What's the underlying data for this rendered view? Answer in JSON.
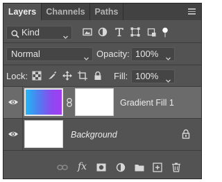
{
  "tabs": [
    {
      "label": "Layers",
      "active": true
    },
    {
      "label": "Channels",
      "active": false
    },
    {
      "label": "Paths",
      "active": false
    }
  ],
  "filter": {
    "type_value": "Kind"
  },
  "blend": {
    "mode": "Normal",
    "opacity_label": "Opacity:",
    "opacity_value": "100%"
  },
  "lock": {
    "label": "Lock:",
    "fill_label": "Fill:",
    "fill_value": "100%"
  },
  "layers": [
    {
      "name": "Gradient Fill 1",
      "visible": true,
      "selected": true,
      "italic": false,
      "locked": false
    },
    {
      "name": "Background",
      "visible": true,
      "selected": false,
      "italic": true,
      "locked": true
    }
  ],
  "colors": {
    "panel_bg": "#535353",
    "tab_bar_bg": "#424242",
    "selected_layer_bg": "#6b6b6b",
    "gradient_start": "#23b8f5",
    "gradient_end": "#a33df2"
  },
  "icons": {
    "filter_icons": [
      "image-filter-icon",
      "adjustment-filter-icon",
      "type-filter-icon",
      "shape-filter-icon",
      "smart-object-filter-icon",
      "filter-toggle-icon"
    ],
    "lock_icons": [
      "lock-transparent-icon",
      "lock-image-icon",
      "lock-position-icon",
      "lock-artboard-icon",
      "lock-all-icon"
    ],
    "bottom_icons": [
      "link-layers-icon",
      "fx-icon",
      "add-mask-icon",
      "adjustment-layer-icon",
      "new-group-icon",
      "new-layer-icon",
      "delete-icon"
    ]
  },
  "bottom": {
    "fx_label": "fx"
  }
}
